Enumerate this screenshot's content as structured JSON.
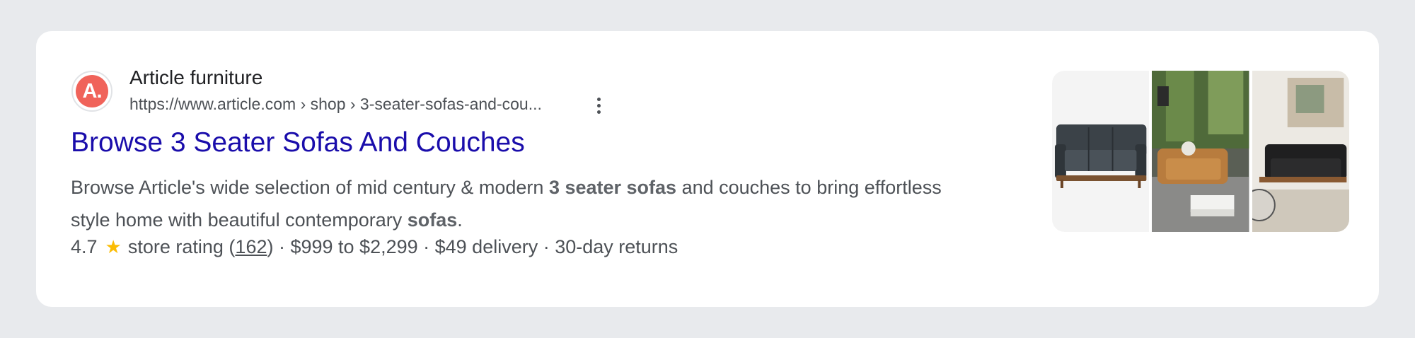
{
  "result": {
    "favicon_letter": "A.",
    "site_name": "Article furniture",
    "url": "https://www.article.com › shop › 3-seater-sofas-and-cou...",
    "title": "Browse 3 Seater Sofas And Couches",
    "snippet": {
      "part1": "Browse Article's wide selection of mid century & modern ",
      "bold1": "3 seater sofas",
      "part2": " and couches to bring effortless style home with beautiful contemporary ",
      "bold2": "sofas",
      "part3": "."
    },
    "rating": "4.7",
    "rating_label": "store rating (",
    "review_count": "162",
    "rating_tail": ") · $999 to $2,299 · $49 delivery · 30-day returns"
  },
  "thumbnails": [
    {
      "alt": "dark-gray-sofa-product-image"
    },
    {
      "alt": "tan-leather-sofa-living-room-image"
    },
    {
      "alt": "black-leather-sofa-room-image"
    }
  ],
  "colors": {
    "title_link": "#1a0dab",
    "favicon_bg": "#f0635a",
    "star": "#fbbc04"
  }
}
